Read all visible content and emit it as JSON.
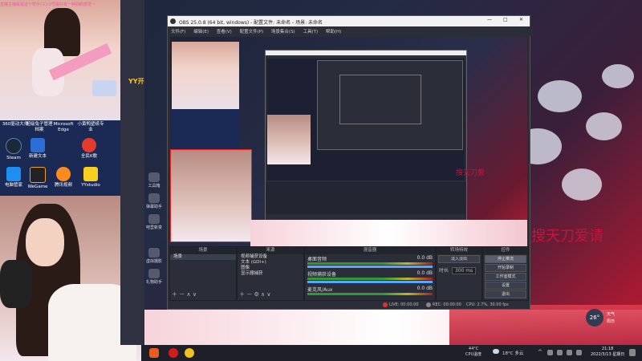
{
  "overlay_text": "直播主播就是这个样子(三)-3号最好有一种别的感觉一",
  "desktop_icons": [
    {
      "label": "360驱动大师",
      "icon": "driver-icon"
    },
    {
      "label": "超级兔子管理 档案",
      "icon": "rabbit-icon"
    },
    {
      "label": "Microsoft Edge",
      "icon": "edge-icon"
    },
    {
      "label": "小黄鸭壁纸专业",
      "icon": "wallpaper-icon"
    },
    {
      "label": "Steam",
      "icon": "steam-icon"
    },
    {
      "label": "新建文本",
      "icon": "doc-icon"
    },
    {
      "label": "全民K歌",
      "icon": "karaoke-icon"
    },
    {
      "label": "电脑管家",
      "icon": "shield-icon"
    },
    {
      "label": "WeGame",
      "icon": "wegame-icon"
    },
    {
      "label": "腾讯视频",
      "icon": "video-icon"
    },
    {
      "label": "YYstudio",
      "icon": "yy-icon"
    }
  ],
  "yy_partial": "YY开",
  "side_panel": [
    "工具箱",
    "弹幕助手",
    "吧里新变",
    "",
    "虚拟摄影",
    "礼物助手"
  ],
  "obs": {
    "title": "OBS 25.0.8 (64 bit, windows) - 配置文件: 未命名 - 场景: 未命名",
    "menu": [
      "文件(F)",
      "编辑(E)",
      "查看(V)",
      "配置文件(P)",
      "场景集合(S)",
      "工具(T)",
      "帮助(H)"
    ],
    "docks": {
      "scenes": "场景",
      "sources": "来源",
      "mixer": "混音器",
      "transitions": "转场特效",
      "controls": "控件"
    },
    "scenes": [
      "场景"
    ],
    "sources": [
      "视频捕获设备",
      "文本 (GDI+)",
      "图像",
      "显示器捕获"
    ],
    "mixer": [
      {
        "name": "桌面音频",
        "db": "0.0 dB"
      },
      {
        "name": "视频捕获设备",
        "db": "0.0 dB"
      },
      {
        "name": "麦克风/Aux",
        "db": "0.0 dB"
      }
    ],
    "transition": {
      "type": "淡入淡出",
      "duration_label": "时长",
      "duration": "300 ms"
    },
    "controls": [
      "停止推流",
      "开始录制",
      "工作室模式",
      "设置",
      "退出"
    ],
    "status": {
      "live": "LIVE: 00:00:00",
      "rec": "REC: 00:00:00",
      "cpu": "CPU: 2.7%, 30.00 fps"
    }
  },
  "promo_text_small": "搜天刀爱",
  "promo_text_big": "搜天刀爱请",
  "weather_badge": {
    "temp": "26°",
    "info1": "天气",
    "info2": "周日"
  },
  "taskbar": {
    "cpu_temp": "44°C",
    "cpu_label": "CPU温度",
    "weather": "18°C 多云",
    "time": "21:18",
    "date": "2022/3/13 星期日"
  }
}
